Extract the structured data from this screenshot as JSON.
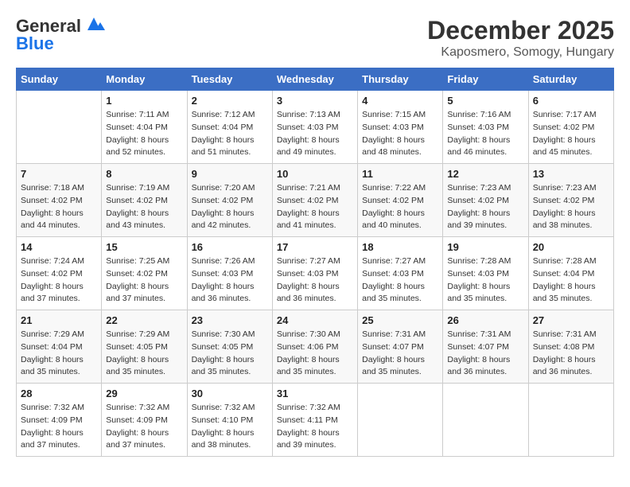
{
  "header": {
    "logo_line1": "General",
    "logo_line2": "Blue",
    "month": "December 2025",
    "location": "Kaposmero, Somogy, Hungary"
  },
  "weekdays": [
    "Sunday",
    "Monday",
    "Tuesday",
    "Wednesday",
    "Thursday",
    "Friday",
    "Saturday"
  ],
  "weeks": [
    [
      {
        "day": "",
        "sunrise": "",
        "sunset": "",
        "daylight": ""
      },
      {
        "day": "1",
        "sunrise": "Sunrise: 7:11 AM",
        "sunset": "Sunset: 4:04 PM",
        "daylight": "Daylight: 8 hours and 52 minutes."
      },
      {
        "day": "2",
        "sunrise": "Sunrise: 7:12 AM",
        "sunset": "Sunset: 4:04 PM",
        "daylight": "Daylight: 8 hours and 51 minutes."
      },
      {
        "day": "3",
        "sunrise": "Sunrise: 7:13 AM",
        "sunset": "Sunset: 4:03 PM",
        "daylight": "Daylight: 8 hours and 49 minutes."
      },
      {
        "day": "4",
        "sunrise": "Sunrise: 7:15 AM",
        "sunset": "Sunset: 4:03 PM",
        "daylight": "Daylight: 8 hours and 48 minutes."
      },
      {
        "day": "5",
        "sunrise": "Sunrise: 7:16 AM",
        "sunset": "Sunset: 4:03 PM",
        "daylight": "Daylight: 8 hours and 46 minutes."
      },
      {
        "day": "6",
        "sunrise": "Sunrise: 7:17 AM",
        "sunset": "Sunset: 4:02 PM",
        "daylight": "Daylight: 8 hours and 45 minutes."
      }
    ],
    [
      {
        "day": "7",
        "sunrise": "Sunrise: 7:18 AM",
        "sunset": "Sunset: 4:02 PM",
        "daylight": "Daylight: 8 hours and 44 minutes."
      },
      {
        "day": "8",
        "sunrise": "Sunrise: 7:19 AM",
        "sunset": "Sunset: 4:02 PM",
        "daylight": "Daylight: 8 hours and 43 minutes."
      },
      {
        "day": "9",
        "sunrise": "Sunrise: 7:20 AM",
        "sunset": "Sunset: 4:02 PM",
        "daylight": "Daylight: 8 hours and 42 minutes."
      },
      {
        "day": "10",
        "sunrise": "Sunrise: 7:21 AM",
        "sunset": "Sunset: 4:02 PM",
        "daylight": "Daylight: 8 hours and 41 minutes."
      },
      {
        "day": "11",
        "sunrise": "Sunrise: 7:22 AM",
        "sunset": "Sunset: 4:02 PM",
        "daylight": "Daylight: 8 hours and 40 minutes."
      },
      {
        "day": "12",
        "sunrise": "Sunrise: 7:23 AM",
        "sunset": "Sunset: 4:02 PM",
        "daylight": "Daylight: 8 hours and 39 minutes."
      },
      {
        "day": "13",
        "sunrise": "Sunrise: 7:23 AM",
        "sunset": "Sunset: 4:02 PM",
        "daylight": "Daylight: 8 hours and 38 minutes."
      }
    ],
    [
      {
        "day": "14",
        "sunrise": "Sunrise: 7:24 AM",
        "sunset": "Sunset: 4:02 PM",
        "daylight": "Daylight: 8 hours and 37 minutes."
      },
      {
        "day": "15",
        "sunrise": "Sunrise: 7:25 AM",
        "sunset": "Sunset: 4:02 PM",
        "daylight": "Daylight: 8 hours and 37 minutes."
      },
      {
        "day": "16",
        "sunrise": "Sunrise: 7:26 AM",
        "sunset": "Sunset: 4:03 PM",
        "daylight": "Daylight: 8 hours and 36 minutes."
      },
      {
        "day": "17",
        "sunrise": "Sunrise: 7:27 AM",
        "sunset": "Sunset: 4:03 PM",
        "daylight": "Daylight: 8 hours and 36 minutes."
      },
      {
        "day": "18",
        "sunrise": "Sunrise: 7:27 AM",
        "sunset": "Sunset: 4:03 PM",
        "daylight": "Daylight: 8 hours and 35 minutes."
      },
      {
        "day": "19",
        "sunrise": "Sunrise: 7:28 AM",
        "sunset": "Sunset: 4:03 PM",
        "daylight": "Daylight: 8 hours and 35 minutes."
      },
      {
        "day": "20",
        "sunrise": "Sunrise: 7:28 AM",
        "sunset": "Sunset: 4:04 PM",
        "daylight": "Daylight: 8 hours and 35 minutes."
      }
    ],
    [
      {
        "day": "21",
        "sunrise": "Sunrise: 7:29 AM",
        "sunset": "Sunset: 4:04 PM",
        "daylight": "Daylight: 8 hours and 35 minutes."
      },
      {
        "day": "22",
        "sunrise": "Sunrise: 7:29 AM",
        "sunset": "Sunset: 4:05 PM",
        "daylight": "Daylight: 8 hours and 35 minutes."
      },
      {
        "day": "23",
        "sunrise": "Sunrise: 7:30 AM",
        "sunset": "Sunset: 4:05 PM",
        "daylight": "Daylight: 8 hours and 35 minutes."
      },
      {
        "day": "24",
        "sunrise": "Sunrise: 7:30 AM",
        "sunset": "Sunset: 4:06 PM",
        "daylight": "Daylight: 8 hours and 35 minutes."
      },
      {
        "day": "25",
        "sunrise": "Sunrise: 7:31 AM",
        "sunset": "Sunset: 4:07 PM",
        "daylight": "Daylight: 8 hours and 35 minutes."
      },
      {
        "day": "26",
        "sunrise": "Sunrise: 7:31 AM",
        "sunset": "Sunset: 4:07 PM",
        "daylight": "Daylight: 8 hours and 36 minutes."
      },
      {
        "day": "27",
        "sunrise": "Sunrise: 7:31 AM",
        "sunset": "Sunset: 4:08 PM",
        "daylight": "Daylight: 8 hours and 36 minutes."
      }
    ],
    [
      {
        "day": "28",
        "sunrise": "Sunrise: 7:32 AM",
        "sunset": "Sunset: 4:09 PM",
        "daylight": "Daylight: 8 hours and 37 minutes."
      },
      {
        "day": "29",
        "sunrise": "Sunrise: 7:32 AM",
        "sunset": "Sunset: 4:09 PM",
        "daylight": "Daylight: 8 hours and 37 minutes."
      },
      {
        "day": "30",
        "sunrise": "Sunrise: 7:32 AM",
        "sunset": "Sunset: 4:10 PM",
        "daylight": "Daylight: 8 hours and 38 minutes."
      },
      {
        "day": "31",
        "sunrise": "Sunrise: 7:32 AM",
        "sunset": "Sunset: 4:11 PM",
        "daylight": "Daylight: 8 hours and 39 minutes."
      },
      {
        "day": "",
        "sunrise": "",
        "sunset": "",
        "daylight": ""
      },
      {
        "day": "",
        "sunrise": "",
        "sunset": "",
        "daylight": ""
      },
      {
        "day": "",
        "sunrise": "",
        "sunset": "",
        "daylight": ""
      }
    ]
  ]
}
